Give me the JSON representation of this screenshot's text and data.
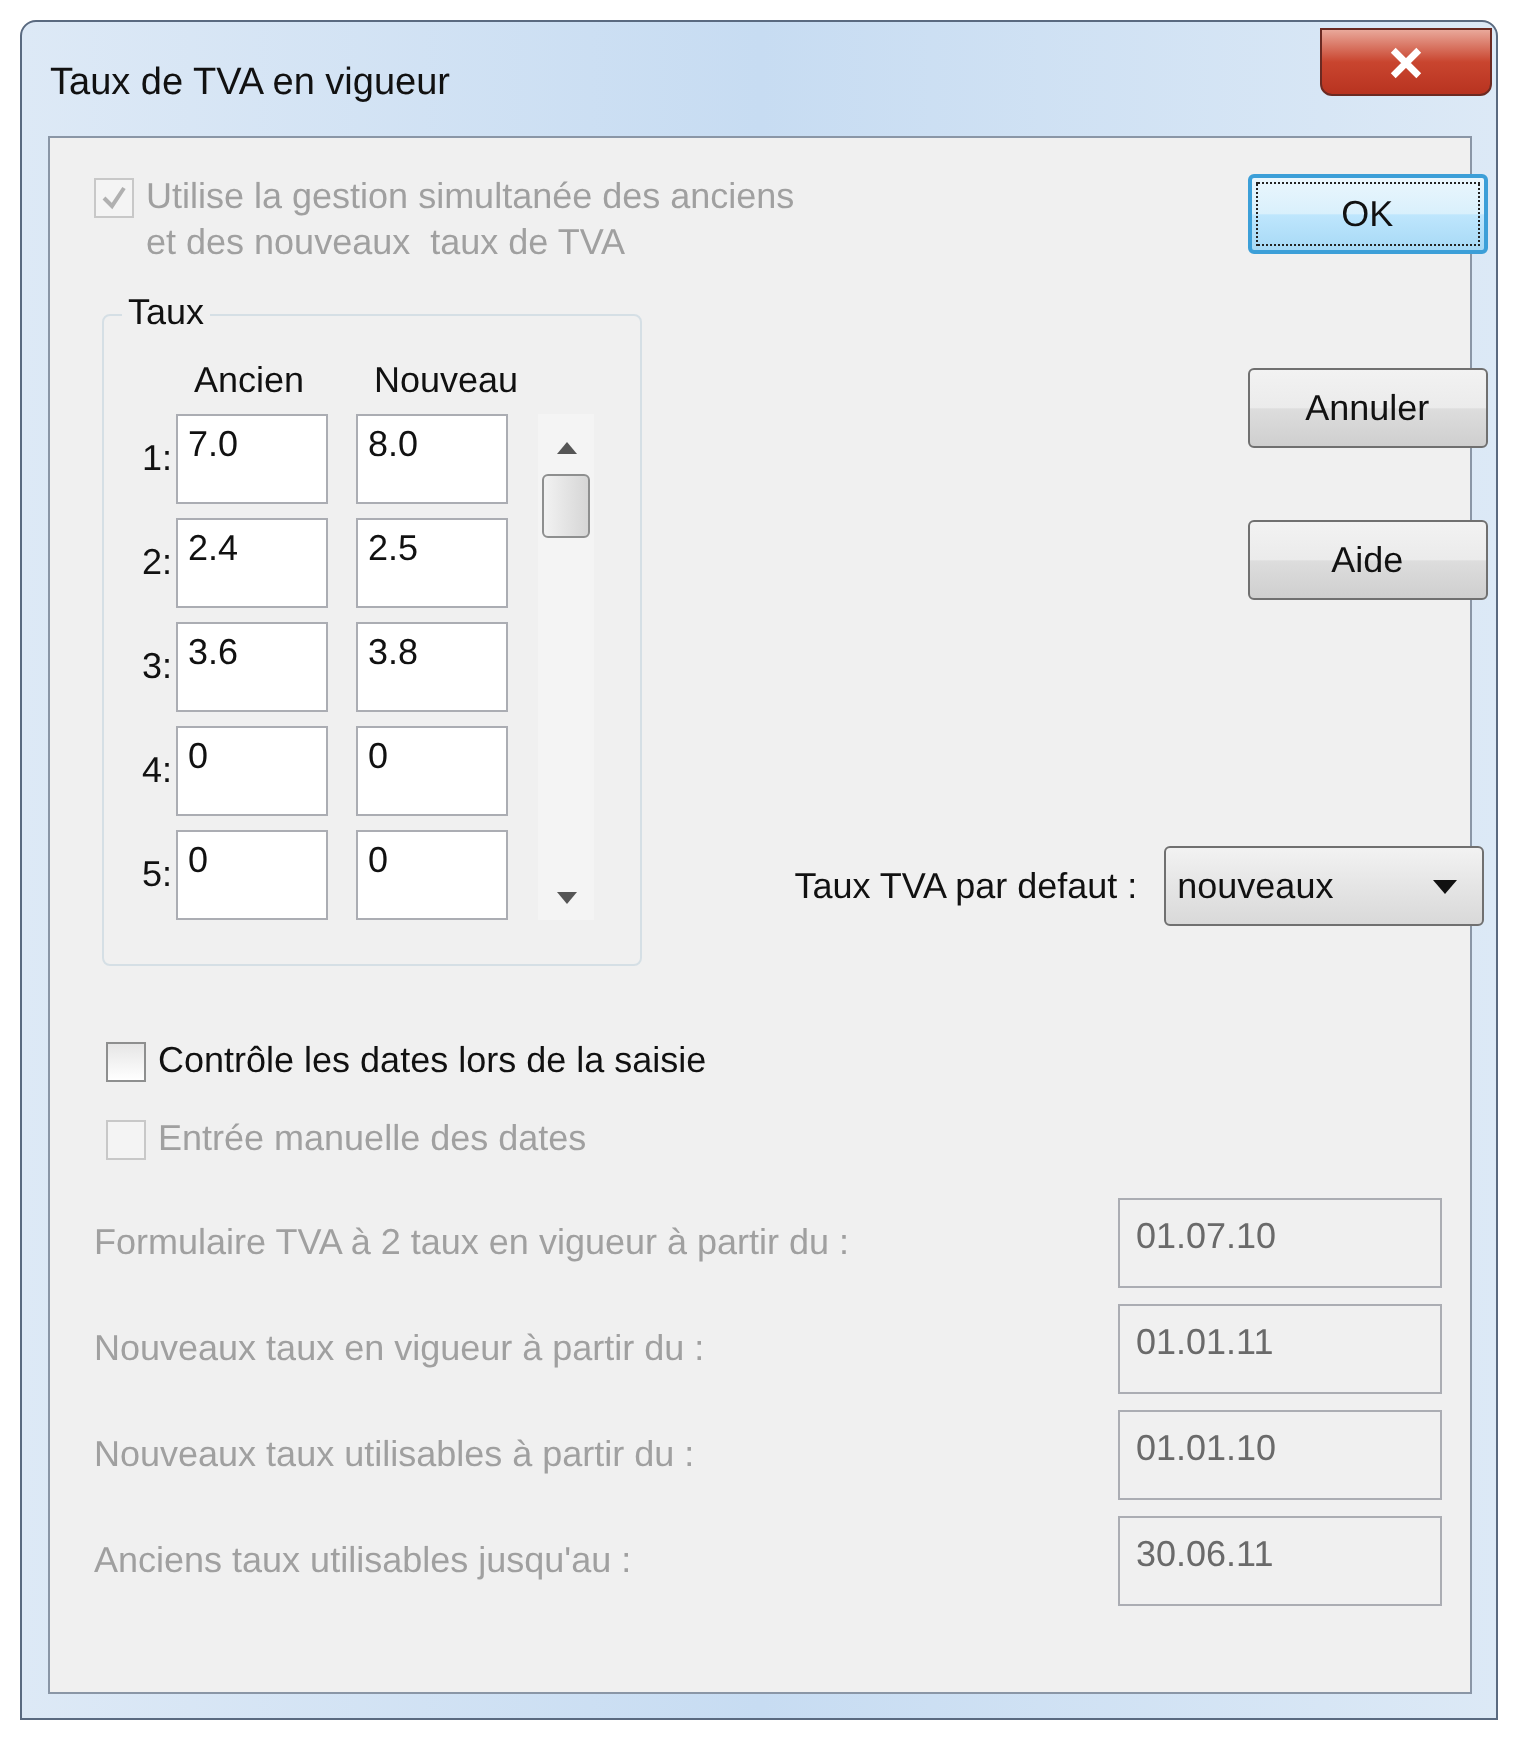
{
  "window": {
    "title": "Taux de TVA en vigueur"
  },
  "options": [
    {
      "label": "Utilise la gestion simultanée des anciens\net des nouveaux  taux de TVA",
      "checked": true,
      "disabled": true
    }
  ],
  "buttons": [
    {
      "label": "OK",
      "default": true
    },
    {
      "label": "Annuler",
      "default": false
    },
    {
      "label": "Aide",
      "default": false
    }
  ],
  "rates_group": {
    "title": "Taux",
    "columns": [
      "Ancien",
      "Nouveau"
    ],
    "rows": [
      {
        "index": "1:",
        "old": "7.0",
        "new": "8.0"
      },
      {
        "index": "2:",
        "old": "2.4",
        "new": "2.5"
      },
      {
        "index": "3:",
        "old": "3.6",
        "new": "3.8"
      },
      {
        "index": "4:",
        "old": "0",
        "new": "0"
      },
      {
        "index": "5:",
        "old": "0",
        "new": "0"
      }
    ]
  },
  "default_rate": {
    "label": "Taux TVA par defaut :",
    "value": "nouveaux"
  },
  "date_options": [
    {
      "label": "Contrôle les dates lors de la saisie",
      "checked": false,
      "disabled": false
    },
    {
      "label": "Entrée manuelle des dates",
      "checked": false,
      "disabled": true
    }
  ],
  "date_fields": [
    {
      "label": "Formulaire TVA à 2 taux en vigueur à partir du :",
      "value": "01.07.10",
      "disabled": true
    },
    {
      "label": "Nouveaux taux en vigueur à partir du :",
      "value": "01.01.11",
      "disabled": true
    },
    {
      "label": "Nouveaux taux utilisables à partir du :",
      "value": "01.01.10",
      "disabled": true
    },
    {
      "label": "Anciens taux utilisables jusqu'au :",
      "value": "30.06.11",
      "disabled": true
    }
  ]
}
